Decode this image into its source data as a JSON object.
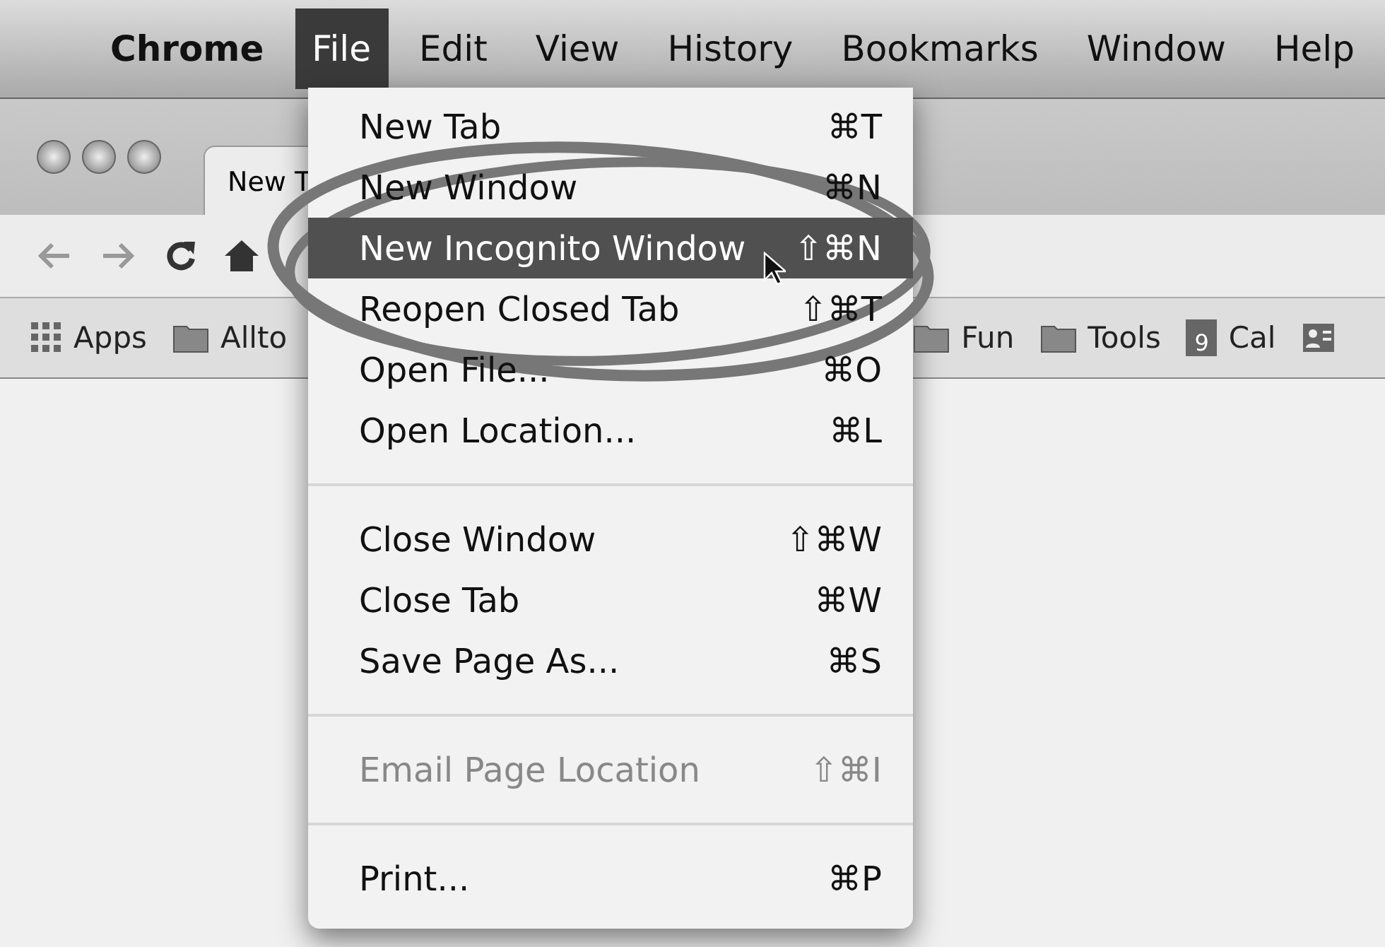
{
  "menu_bar": {
    "items": [
      {
        "label": "Chrome",
        "selected": false
      },
      {
        "label": "File",
        "selected": true
      },
      {
        "label": "Edit",
        "selected": false
      },
      {
        "label": "View",
        "selected": false
      },
      {
        "label": "History",
        "selected": false
      },
      {
        "label": "Bookmarks",
        "selected": false
      },
      {
        "label": "Window",
        "selected": false
      },
      {
        "label": "Help",
        "selected": false
      }
    ]
  },
  "tab": {
    "title": "New T"
  },
  "bookmarks": [
    {
      "label": "Apps",
      "kind": "apps"
    },
    {
      "label": "Allto",
      "kind": "folder"
    },
    {
      "label": "Fun",
      "kind": "folder"
    },
    {
      "label": "Tools",
      "kind": "folder"
    },
    {
      "label": "Cal",
      "kind": "calendar",
      "badge": "9"
    },
    {
      "kind": "contacts"
    }
  ],
  "file_menu": {
    "items": [
      {
        "kind": "item",
        "label": "New Tab",
        "shortcut": "⌘T",
        "selected": false,
        "disabled": false
      },
      {
        "kind": "item",
        "label": "New Window",
        "shortcut": "⌘N",
        "selected": false,
        "disabled": false
      },
      {
        "kind": "item",
        "label": "New Incognito Window",
        "shortcut": "⇧⌘N",
        "selected": true,
        "disabled": false
      },
      {
        "kind": "item",
        "label": "Reopen Closed Tab",
        "shortcut": "⇧⌘T",
        "selected": false,
        "disabled": false
      },
      {
        "kind": "item",
        "label": "Open File...",
        "shortcut": "⌘O",
        "selected": false,
        "disabled": false
      },
      {
        "kind": "item",
        "label": "Open Location...",
        "shortcut": "⌘L",
        "selected": false,
        "disabled": false
      },
      {
        "kind": "separator"
      },
      {
        "kind": "item",
        "label": "Close Window",
        "shortcut": "⇧⌘W",
        "selected": false,
        "disabled": false
      },
      {
        "kind": "item",
        "label": "Close Tab",
        "shortcut": "⌘W",
        "selected": false,
        "disabled": false
      },
      {
        "kind": "item",
        "label": "Save Page As...",
        "shortcut": "⌘S",
        "selected": false,
        "disabled": false
      },
      {
        "kind": "separator"
      },
      {
        "kind": "item",
        "label": "Email Page Location",
        "shortcut": "⇧⌘I",
        "selected": false,
        "disabled": true
      },
      {
        "kind": "separator"
      },
      {
        "kind": "item",
        "label": "Print...",
        "shortcut": "⌘P",
        "selected": false,
        "disabled": false
      }
    ]
  }
}
